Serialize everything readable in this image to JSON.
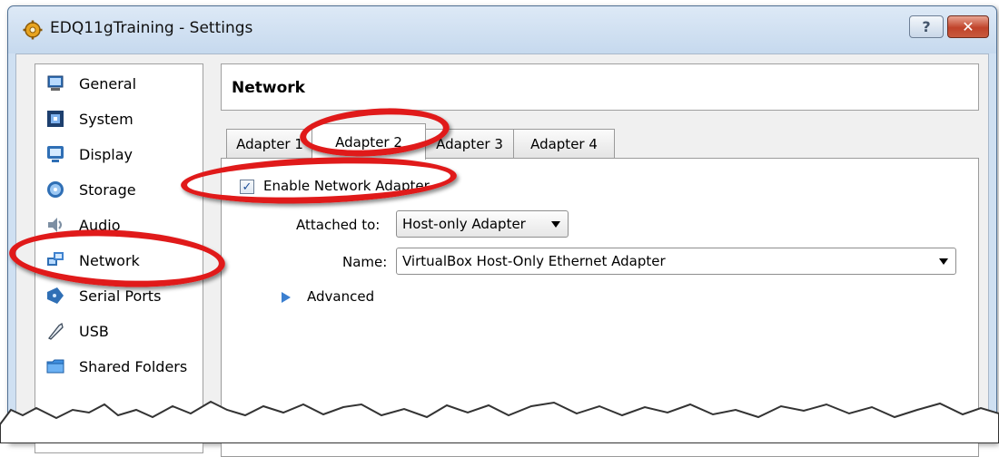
{
  "window": {
    "title": "EDQ11gTraining - Settings",
    "help_button": "?",
    "close_button": "✕",
    "app_icon": "gear-icon"
  },
  "sidebar": {
    "items": [
      {
        "label": "General",
        "icon": "monitor-icon"
      },
      {
        "label": "System",
        "icon": "chip-icon"
      },
      {
        "label": "Display",
        "icon": "display-icon"
      },
      {
        "label": "Storage",
        "icon": "disk-icon"
      },
      {
        "label": "Audio",
        "icon": "speaker-icon"
      },
      {
        "label": "Network",
        "icon": "network-icon"
      },
      {
        "label": "Serial Ports",
        "icon": "serial-port-icon"
      },
      {
        "label": "USB",
        "icon": "usb-icon"
      },
      {
        "label": "Shared Folders",
        "icon": "folder-icon"
      }
    ],
    "selected": "Network"
  },
  "main": {
    "section_title": "Network",
    "tabs": [
      {
        "label": "Adapter 1"
      },
      {
        "label": "Adapter 2"
      },
      {
        "label": "Adapter 3"
      },
      {
        "label": "Adapter 4"
      }
    ],
    "active_tab": "Adapter 2",
    "enable_checkbox": {
      "label": "Enable Network Adapter",
      "checked": true,
      "mark": "✓"
    },
    "attached_to": {
      "label": "Attached to:",
      "value": "Host-only Adapter"
    },
    "name": {
      "label": "Name:",
      "value": "VirtualBox Host-Only Ethernet Adapter"
    },
    "advanced": {
      "label": "Advanced",
      "expanded": false
    }
  },
  "annotations": {
    "ring_color": "#e01a1a"
  },
  "colors": {
    "window_frame": "#cfe0f2",
    "panel": "#f0f0f0",
    "accent": "#3b7fd0"
  }
}
